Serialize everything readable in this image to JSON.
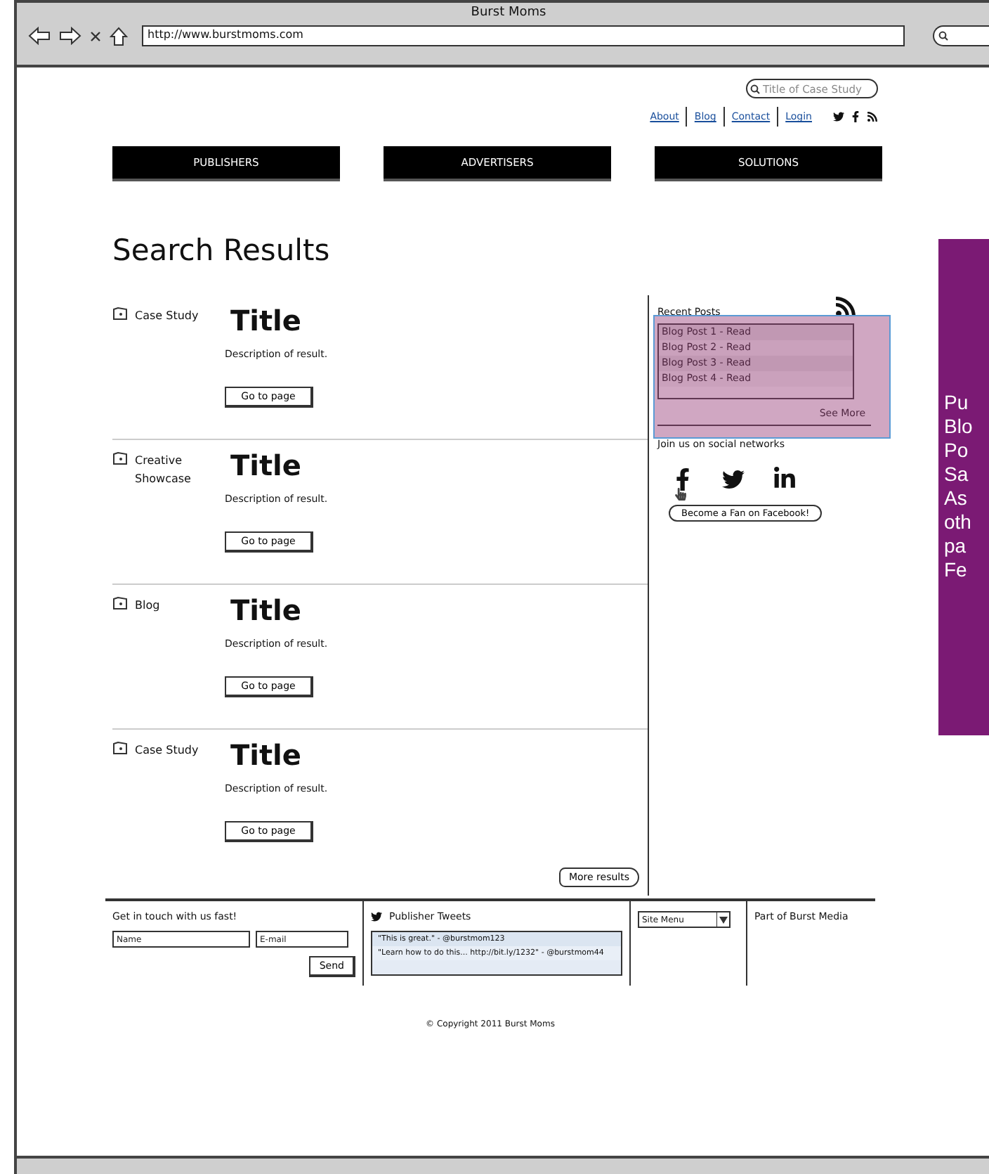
{
  "window": {
    "title": "Burst Moms",
    "address": "http://www.burstmoms.com"
  },
  "header": {
    "search": {
      "placeholder": "Title of Case Study"
    },
    "links": [
      "About",
      "Blog",
      "Contact",
      "Login"
    ]
  },
  "nav": [
    "PUBLISHERS",
    "ADVERTISERS",
    "SOLUTIONS"
  ],
  "heading": "Search Results",
  "results": [
    {
      "type": "Case Study",
      "title": "Title",
      "description": "Description of result.",
      "button": "Go to page"
    },
    {
      "type": "Creative Showcase",
      "title": "Title",
      "description": "Description of result.",
      "button": "Go to page"
    },
    {
      "type": "Blog",
      "title": "Title",
      "description": "Description of result.",
      "button": "Go to page"
    },
    {
      "type": "Case Study",
      "title": "Title",
      "description": "Description of result.",
      "button": "Go to page"
    }
  ],
  "more_results": "More results",
  "sidebar": {
    "recent_posts": {
      "title": "Recent Posts",
      "posts": [
        "Blog Post 1 - Read",
        "Blog Post 2 - Read",
        "Blog Post 3 - Read",
        "Blog Post 4 - Read"
      ],
      "see_more": "See More"
    },
    "social": {
      "title": "Join us on social networks",
      "fan_button": "Become a Fan on Facebook!"
    }
  },
  "footer": {
    "contact": {
      "title": "Get in touch with us fast!",
      "name_placeholder": "Name",
      "email_placeholder": "E-mail",
      "send": "Send"
    },
    "tweets": {
      "title": "Publisher Tweets",
      "items": [
        "\"This is great.\" - @burstmom123",
        "\"Learn how to do this... http://bit.ly/1232\" - @burstmom44"
      ]
    },
    "site_menu": "Site Menu",
    "affiliation": "Part of Burst Media",
    "copyright": "© Copyright 2011 Burst Moms"
  },
  "note": {
    "lines": [
      "Pu",
      "Blo",
      "Po",
      "Sa",
      "As",
      "oth",
      "pa",
      "Fe"
    ]
  }
}
